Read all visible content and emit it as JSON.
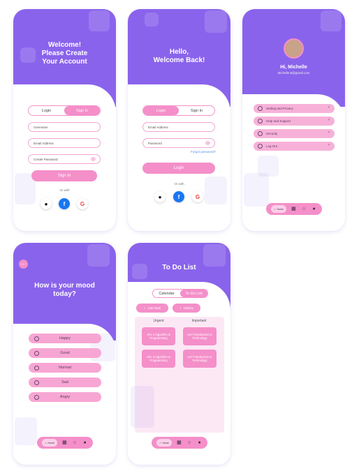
{
  "signup": {
    "title_line1": "Welcome!",
    "title_line2": "Please Create",
    "title_line3": "Your Account",
    "tab_login": "Login",
    "tab_signin": "Sign In",
    "username_placeholder": "Username",
    "email_placeholder": "Email Address",
    "password_placeholder": "Create Password",
    "submit_label": "Sign In",
    "or_with": "Or with"
  },
  "login": {
    "title_line1": "Hello,",
    "title_line2": "Welcome Back!",
    "tab_login": "Login",
    "tab_signin": "Sign In",
    "email_placeholder": "Email Address",
    "password_placeholder": "Password",
    "forgot": "Forgot password?",
    "submit_label": "Login",
    "or_with": "Or with"
  },
  "profile": {
    "name": "Hi, Michelle",
    "email": "Michelle.B@gmail.com",
    "menu": [
      "Setting and Privacy",
      "Help and Support",
      "Security",
      "Log Out"
    ]
  },
  "mood": {
    "title_line1": "How is your mood",
    "title_line2": "today?",
    "options": [
      "Happy",
      "Good",
      "Normal",
      "Sad",
      "Angry"
    ]
  },
  "todo": {
    "title": "To Do List",
    "tab_calendar": "Calendar",
    "tab_todo": "To Do List",
    "add_task": "Add Task",
    "history": "History",
    "col_urgent": "Urgent",
    "col_important": "Important",
    "tasks_urgent": [
      "AFL 2 Algorithm & Programming",
      "AFL 3 Algorithm & Programming"
    ],
    "tasks_important": [
      "ALP Introduction to Technology",
      "ALP Introduction to Technology"
    ]
  },
  "nav": {
    "home": "Home"
  },
  "social": {
    "apple": "",
    "facebook": "f",
    "google": "G"
  },
  "colors": {
    "purple": "#8a63ec",
    "pink": "#f48fc9",
    "light_pink": "#fbe8f4"
  }
}
